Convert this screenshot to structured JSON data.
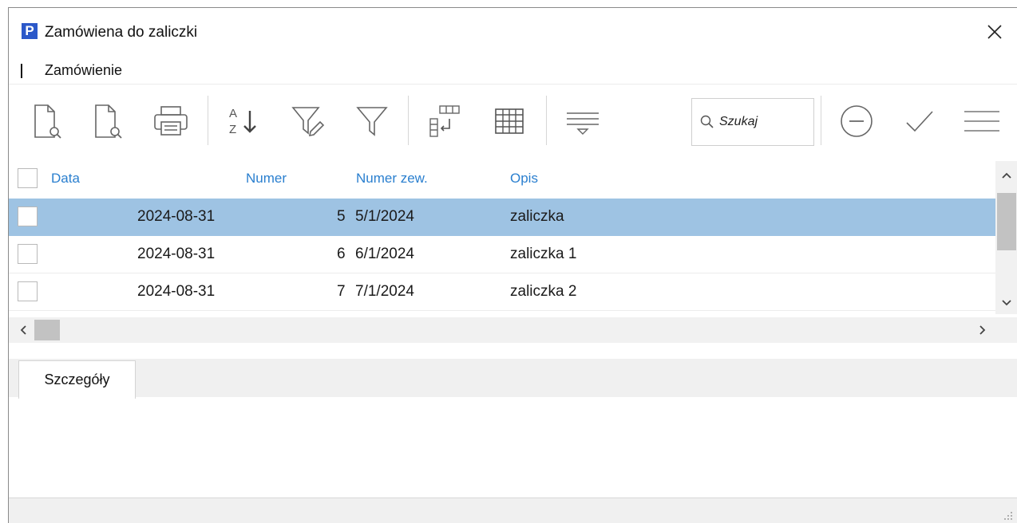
{
  "window": {
    "title": "Zamówiena do zaliczki",
    "logo_letter": "P"
  },
  "menu": {
    "items": [
      {
        "label": "Zamówienie"
      }
    ]
  },
  "toolbar": {
    "search_placeholder": "Szukaj",
    "buttons": [
      "new-document-icon",
      "preview-document-icon",
      "print-icon",
      "sort-az-icon",
      "edit-filter-icon",
      "filter-icon",
      "group-columns-icon",
      "grid-icon",
      "summary-lines-icon",
      "minus-circle-icon",
      "checkmark-icon",
      "menu-icon"
    ]
  },
  "grid": {
    "columns": [
      "Data",
      "Numer",
      "Numer zew.",
      "Opis"
    ],
    "rows": [
      {
        "data": "2024-08-31",
        "numer": "5",
        "numer_zew": "5/1/2024",
        "opis": "zaliczka",
        "selected": true
      },
      {
        "data": "2024-08-31",
        "numer": "6",
        "numer_zew": "6/1/2024",
        "opis": "zaliczka 1",
        "selected": false
      },
      {
        "data": "2024-08-31",
        "numer": "7",
        "numer_zew": "7/1/2024",
        "opis": "zaliczka 2",
        "selected": false
      }
    ]
  },
  "details": {
    "tabs": [
      {
        "label": "Szczegóły"
      }
    ]
  },
  "colors": {
    "accent": "#2a7fcf",
    "selected_row": "#9ec3e3",
    "logo": "#2b58c9"
  }
}
